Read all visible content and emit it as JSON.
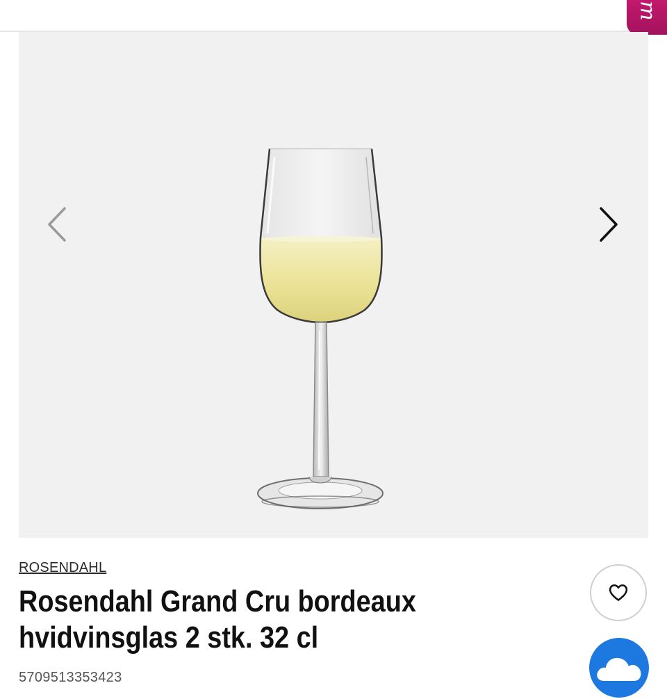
{
  "header": {
    "corner_tab_glyph": "m"
  },
  "gallery": {
    "prev_icon": "chevron-left-icon",
    "next_icon": "chevron-right-icon",
    "image_subject": "wine-glass-with-white-wine"
  },
  "product": {
    "brand": "ROSENDAHL",
    "title_line1": "Rosendahl Grand Cru bordeaux",
    "title_line2": "hvidvinsglas 2 stk. 32 cl",
    "ean": "5709513353423"
  },
  "actions": {
    "favorite_icon": "heart-icon",
    "chat_icon": "cloud-icon"
  },
  "colors": {
    "accent": "#b5156a",
    "cloud_button": "#1d78e0",
    "gallery_bg": "#f1f1f1"
  }
}
